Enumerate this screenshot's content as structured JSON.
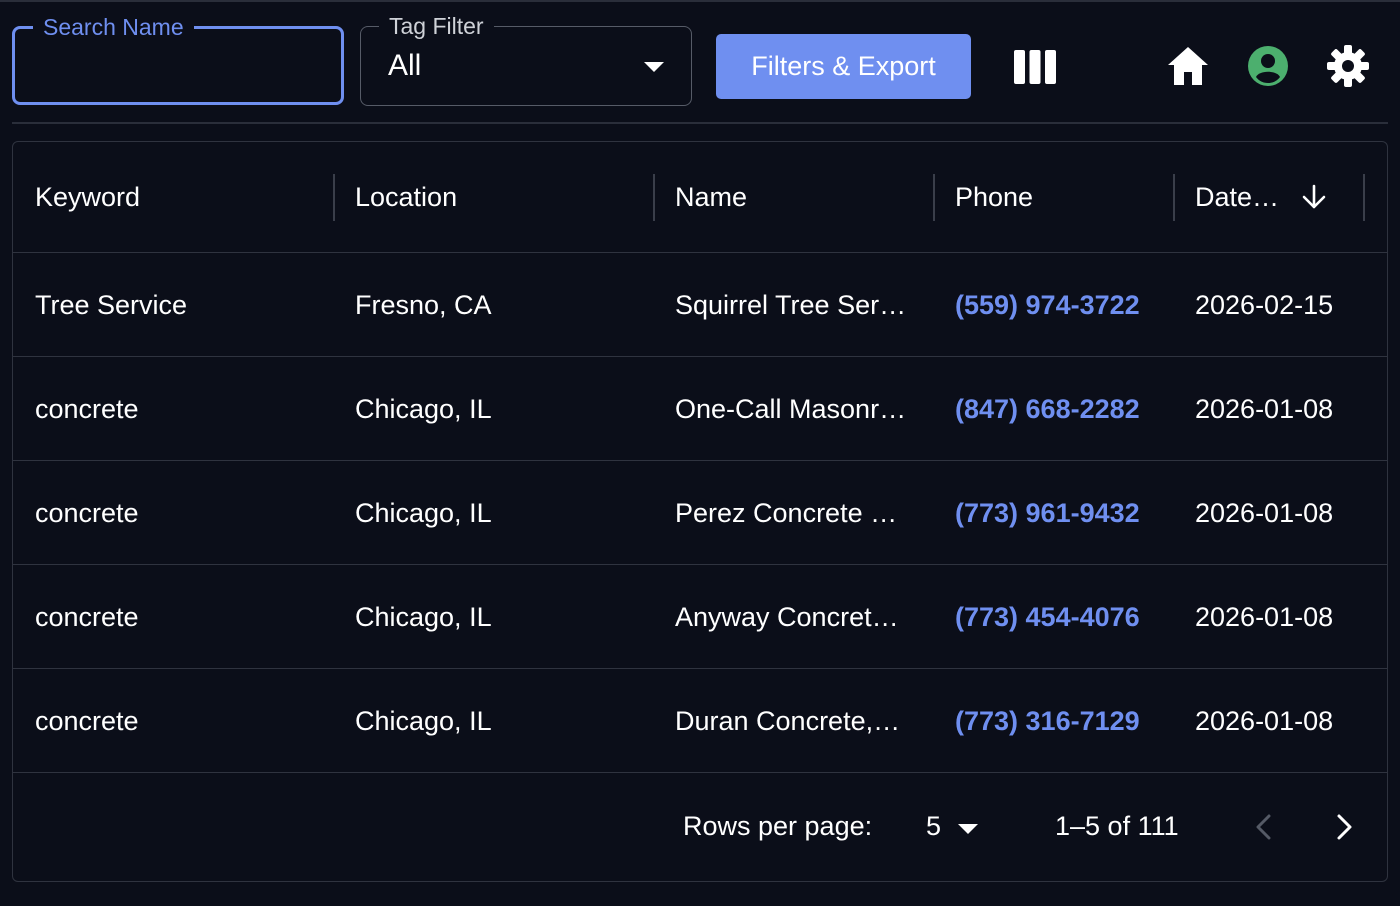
{
  "toolbar": {
    "search": {
      "label": "Search Name",
      "value": "",
      "placeholder": ""
    },
    "tag_filter": {
      "label": "Tag Filter",
      "value": "All"
    },
    "export_label": "Filters & Export",
    "icons": [
      "columns-icon",
      "home-icon",
      "account-icon",
      "gear-icon"
    ],
    "colors": {
      "accent": "#6f8ff0",
      "account": "#4caf6e",
      "background": "#0b0e19"
    }
  },
  "table": {
    "columns": [
      "Keyword",
      "Location",
      "Name",
      "Phone",
      "Date…"
    ],
    "sort": {
      "column": "Date…",
      "direction": "descending"
    },
    "rows": [
      {
        "keyword": "Tree Service",
        "location": "Fresno, CA",
        "name": "Squirrel Tree Ser…",
        "phone": "(559) 974-3722",
        "date": "2026-02-15"
      },
      {
        "keyword": "concrete",
        "location": "Chicago, IL",
        "name": "One-Call Masonr…",
        "phone": "(847) 668-2282",
        "date": "2026-01-08"
      },
      {
        "keyword": "concrete",
        "location": "Chicago, IL",
        "name": "Perez Concrete …",
        "phone": "(773) 961-9432",
        "date": "2026-01-08"
      },
      {
        "keyword": "concrete",
        "location": "Chicago, IL",
        "name": "Anyway Concret…",
        "phone": "(773) 454-4076",
        "date": "2026-01-08"
      },
      {
        "keyword": "concrete",
        "location": "Chicago, IL",
        "name": "Duran Concrete,…",
        "phone": "(773) 316-7129",
        "date": "2026-01-08"
      }
    ]
  },
  "pagination": {
    "rows_per_page_label": "Rows per page:",
    "rows_per_page": "5",
    "range": "1–5 of 111"
  }
}
